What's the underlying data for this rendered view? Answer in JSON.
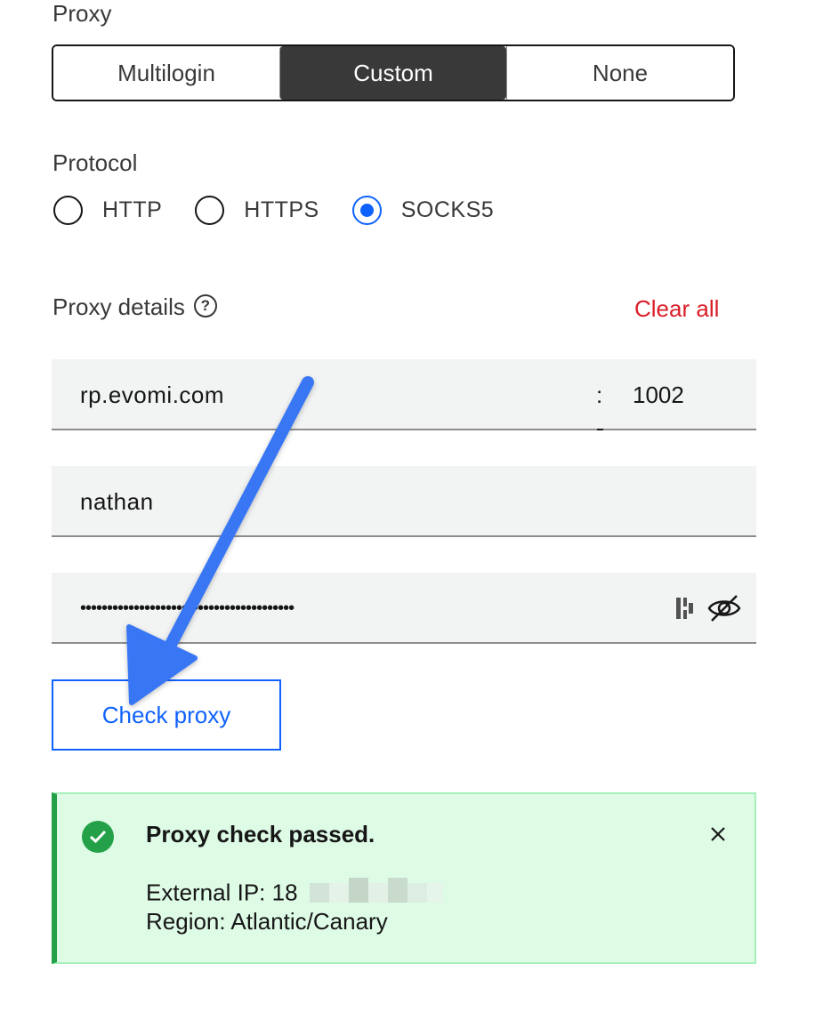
{
  "proxy": {
    "label": "Proxy",
    "options": [
      "Multilogin",
      "Custom",
      "None"
    ],
    "selected": "Custom"
  },
  "protocol": {
    "label": "Protocol",
    "options": [
      "HTTP",
      "HTTPS",
      "SOCKS5"
    ],
    "selected": "SOCKS5"
  },
  "details": {
    "label": "Proxy details",
    "help_icon": "question-circle-icon",
    "clear_all": "Clear all",
    "host": "rp.evomi.com",
    "separator": ":",
    "port": "1002",
    "username": "nathan",
    "password_mask": "••••••••••••••••••••••••••••••••••••••••"
  },
  "check_button": "Check proxy",
  "result": {
    "title": "Proxy check passed.",
    "ip_label": "External IP: 18",
    "region": "Region: Atlantic/Canary",
    "status_color": "#24a148",
    "close_icon": "close-icon"
  },
  "accent_color": "#0f62fe",
  "annotation_arrow_color": "#3776f4"
}
